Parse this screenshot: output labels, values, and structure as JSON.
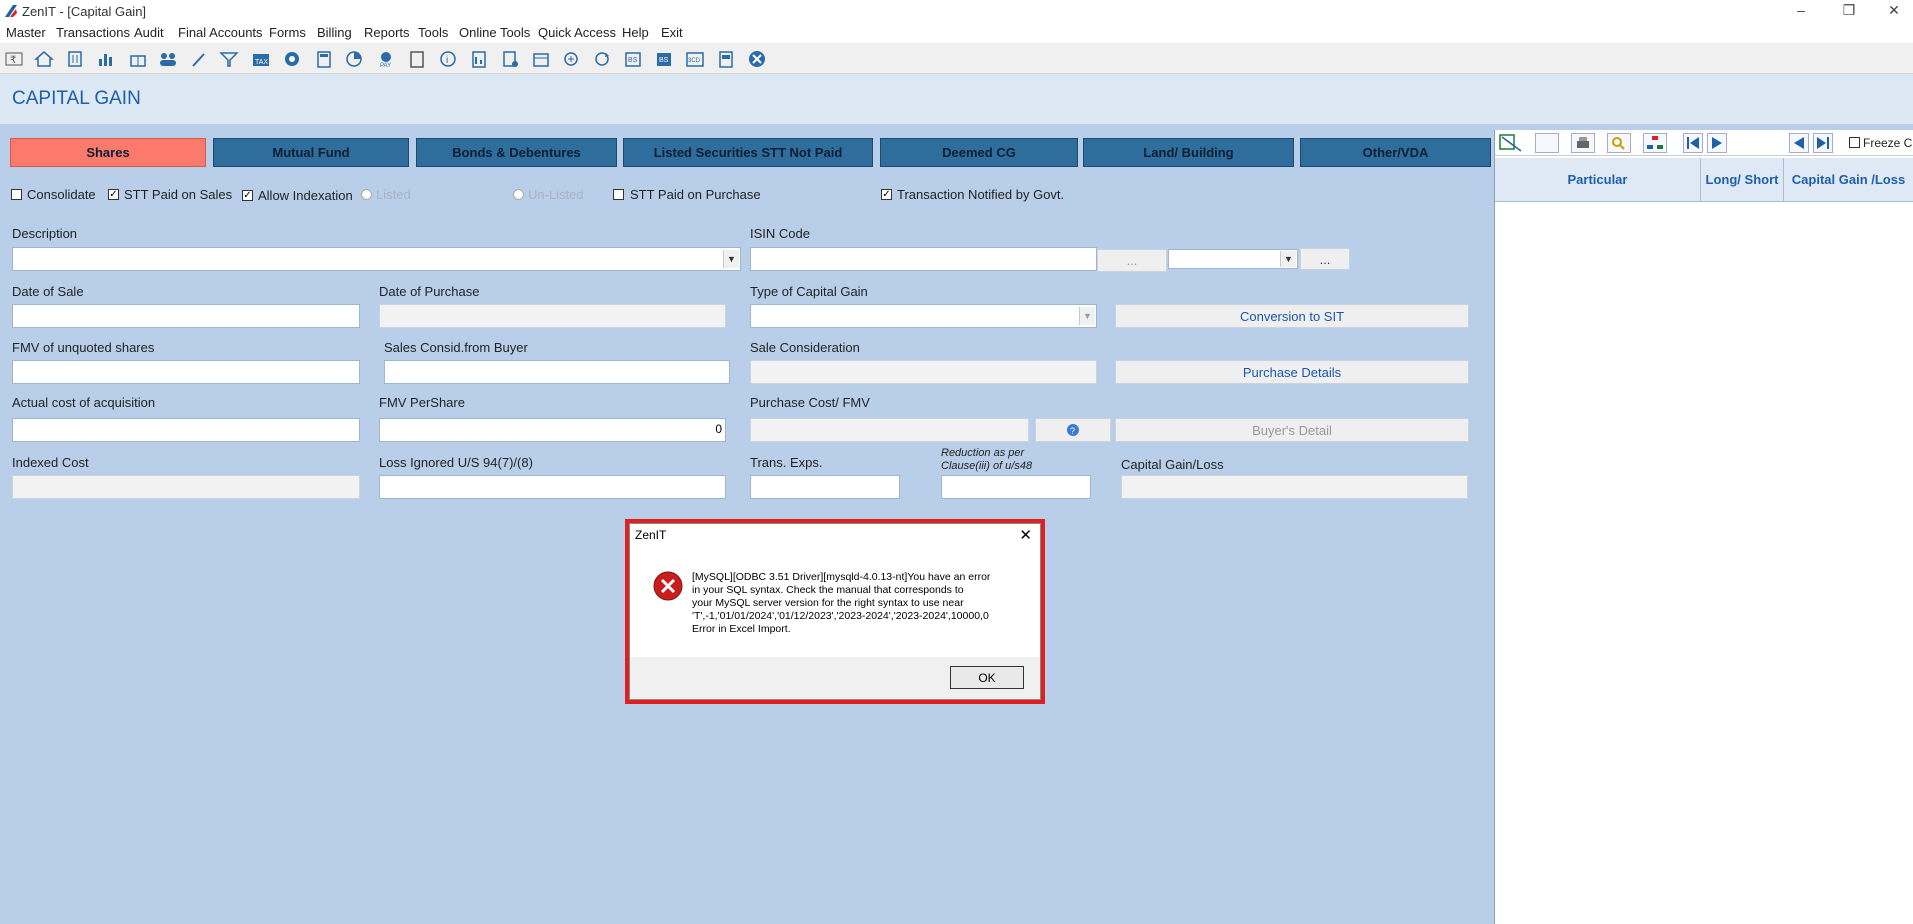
{
  "window": {
    "title": "ZenIT - [Capital Gain]"
  },
  "menu": [
    "Master",
    "Transactions",
    "Audit",
    "Final Accounts",
    "Forms",
    "Billing",
    "Reports",
    "Tools",
    "Online Tools",
    "Quick Access",
    "Help",
    "Exit"
  ],
  "toolbar_icons": [
    "rupee-icon",
    "home-icon",
    "building-icon",
    "chart-icon",
    "gift-icon",
    "users-icon",
    "pin-icon",
    "filter-icon",
    "tax-icon",
    "eye-icon",
    "calculator-icon",
    "pie-icon",
    "pay-icon",
    "book-icon",
    "info-icon",
    "report-icon",
    "document-icon",
    "calendar-icon",
    "add-icon",
    "refresh-icon",
    "bs-icon",
    "bs2-icon",
    "3cd-icon",
    "form-icon",
    "close-icon"
  ],
  "header": {
    "title": "CAPITAL GAIN"
  },
  "tabs": [
    "Shares",
    "Mutual Fund",
    "Bonds & Debentures",
    "Listed Securities STT Not Paid",
    "Deemed CG",
    "Land/ Building",
    "Other/VDA"
  ],
  "options": {
    "consolidate": "Consolidate",
    "stt_sales": "STT Paid on Sales",
    "allow_indexation": "Allow Indexation",
    "listed": "Listed",
    "unlisted": "Un-Listed",
    "stt_purchase": "STT Paid on Purchase",
    "notified": "Transaction Notified by Govt."
  },
  "fields": {
    "description": "Description",
    "isin": "ISIN Code",
    "isin_btn": "...",
    "isin_btn2": "...",
    "date_sale": "Date of Sale",
    "date_purchase": "Date of Purchase",
    "type_cg": "Type of Capital Gain",
    "conversion": "Conversion to SIT",
    "fmv_unquoted": "FMV of unquoted shares",
    "sales_consid_buyer": "Sales Consid.from Buyer",
    "sale_consideration": "Sale Consideration",
    "purchase_details": "Purchase Details",
    "actual_cost": "Actual cost of acquisition",
    "fmv_pershare": "FMV PerShare",
    "fmv_pershare_value": "0",
    "purchase_cost": "Purchase Cost/ FMV",
    "buyers_detail": "Buyer's Detail",
    "indexed_cost": "Indexed Cost",
    "loss_ignored": "Loss Ignored U/S 94(7)/(8)",
    "trans_exps": "Trans. Exps.",
    "reduction": "Reduction as per Clause(iii) of u/s48",
    "capital_gain_loss": "Capital Gain/Loss"
  },
  "right_panel": {
    "freeze": "Freeze C",
    "columns": [
      "Particular",
      "Long/ Short",
      "Capital Gain /Loss"
    ]
  },
  "dialog": {
    "title": "ZenIT",
    "message": "[MySQL][ODBC 3.51 Driver][mysqld-4.0.13-nt]You have an error\nin your SQL syntax.  Check the manual that corresponds to\nyour MySQL server version for the right syntax to use near\n'T',-1,'01/01/2024','01/12/2023','2023-2024','2023-2024',10000,0\nError in Excel Import.",
    "ok": "OK"
  },
  "colors": {
    "accent": "#1e5fa8",
    "tab": "#2f6e9c",
    "active_tab": "#fb7a6c",
    "bg": "#b9cfe9",
    "error": "#e02020"
  }
}
